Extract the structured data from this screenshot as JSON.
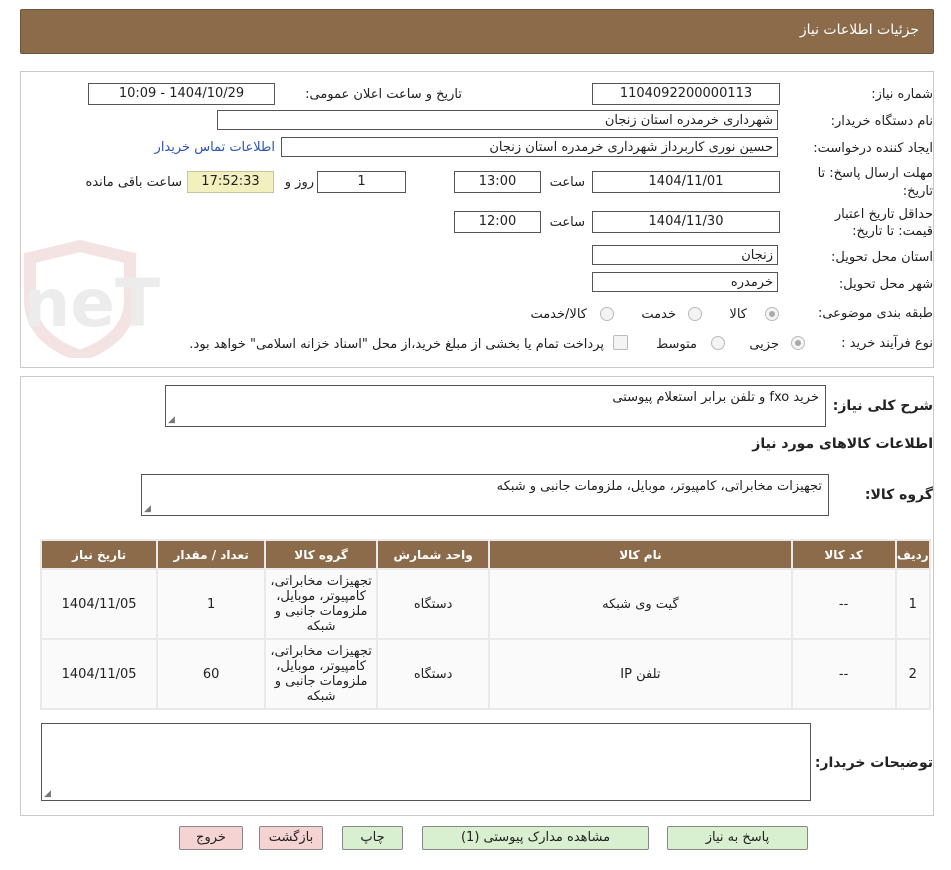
{
  "header": {
    "title": "جزئیات اطلاعات نیاز"
  },
  "form": {
    "need_number_label": "شماره نیاز:",
    "need_number": "1104092200000113",
    "announce_label": "تاریخ و ساعت اعلان عمومی:",
    "announce_value": "1404/10/29 - 10:09",
    "buyer_org_label": "نام دستگاه خریدار:",
    "buyer_org": "شهرداری خرمدره استان زنجان",
    "creator_label": "ایجاد کننده درخواست:",
    "creator": "حسین نوری کاربرداز شهرداری خرمدره استان زنجان",
    "contact_link": "اطلاعات تماس خریدار",
    "deadline_label_1": "مهلت ارسال پاسخ: تا",
    "deadline_label_2": "تاریخ:",
    "deadline_date": "1404/11/01",
    "hour_label": "ساعت",
    "deadline_time": "13:00",
    "days_value": "1",
    "days_label": "روز و",
    "timer": "17:52:33",
    "remaining_label": "ساعت باقی مانده",
    "validity_label_1": "حداقل تاریخ اعتبار",
    "validity_label_2": "قیمت: تا تاریخ:",
    "validity_date": "1404/11/30",
    "validity_time": "12:00",
    "province_label": "استان محل تحویل:",
    "province": "زنجان",
    "city_label": "شهر محل تحویل:",
    "city": "خرمدره",
    "category_label": "طبقه بندی موضوعی:",
    "cat_goods": "کالا",
    "cat_service": "خدمت",
    "cat_both": "کالا/خدمت",
    "process_label": "نوع فرآیند خرید :",
    "proc_minor": "جزیی",
    "proc_medium": "متوسط",
    "payment_note": "پرداخت تمام یا بخشی از مبلغ خرید،از محل \"اسناد خزانه اسلامی\" خواهد بود."
  },
  "desc": {
    "label": "شرح کلی نیاز:",
    "value": "خرید fxo و تلفن برابر استعلام پیوستی",
    "goods_info_title": "اطلاعات کالاهای مورد نیاز",
    "group_label": "گروه کالا:",
    "group_value": "تجهیزات مخابراتی، کامپیوتر، موبایل، ملزومات جانبی و شبکه"
  },
  "table": {
    "headers": [
      "ردیف",
      "کد کالا",
      "نام کالا",
      "واحد شمارش",
      "گروه کالا",
      "تعداد / مقدار",
      "تاریخ نیاز"
    ],
    "rows": [
      [
        "1",
        "--",
        "گیت وی شبکه",
        "دستگاه",
        "تجهیزات مخابراتی، کامپیوتر، موبایل، ملزومات جانبی و شبکه",
        "1",
        "1404/11/05"
      ],
      [
        "2",
        "--",
        "تلفن IP",
        "دستگاه",
        "تجهیزات مخابراتی، کامپیوتر، موبایل، ملزومات جانبی و شبکه",
        "60",
        "1404/11/05"
      ]
    ]
  },
  "buyer_notes": {
    "label": "توضیحات خریدار:",
    "value": ""
  },
  "buttons": {
    "respond": "پاسخ به نیاز",
    "attachments": "مشاهده مدارک پیوستی (1)",
    "print": "چاپ",
    "back": "بازگشت",
    "exit": "خروج"
  },
  "watermark": {
    "text": "AriaTender.neT"
  },
  "colors": {
    "header_bg": "#8b6b4a",
    "link": "#2a55b8",
    "timer_bg": "#f3f0c0",
    "button_green": "#d8f0d0",
    "button_red": "#f6d3d3"
  }
}
